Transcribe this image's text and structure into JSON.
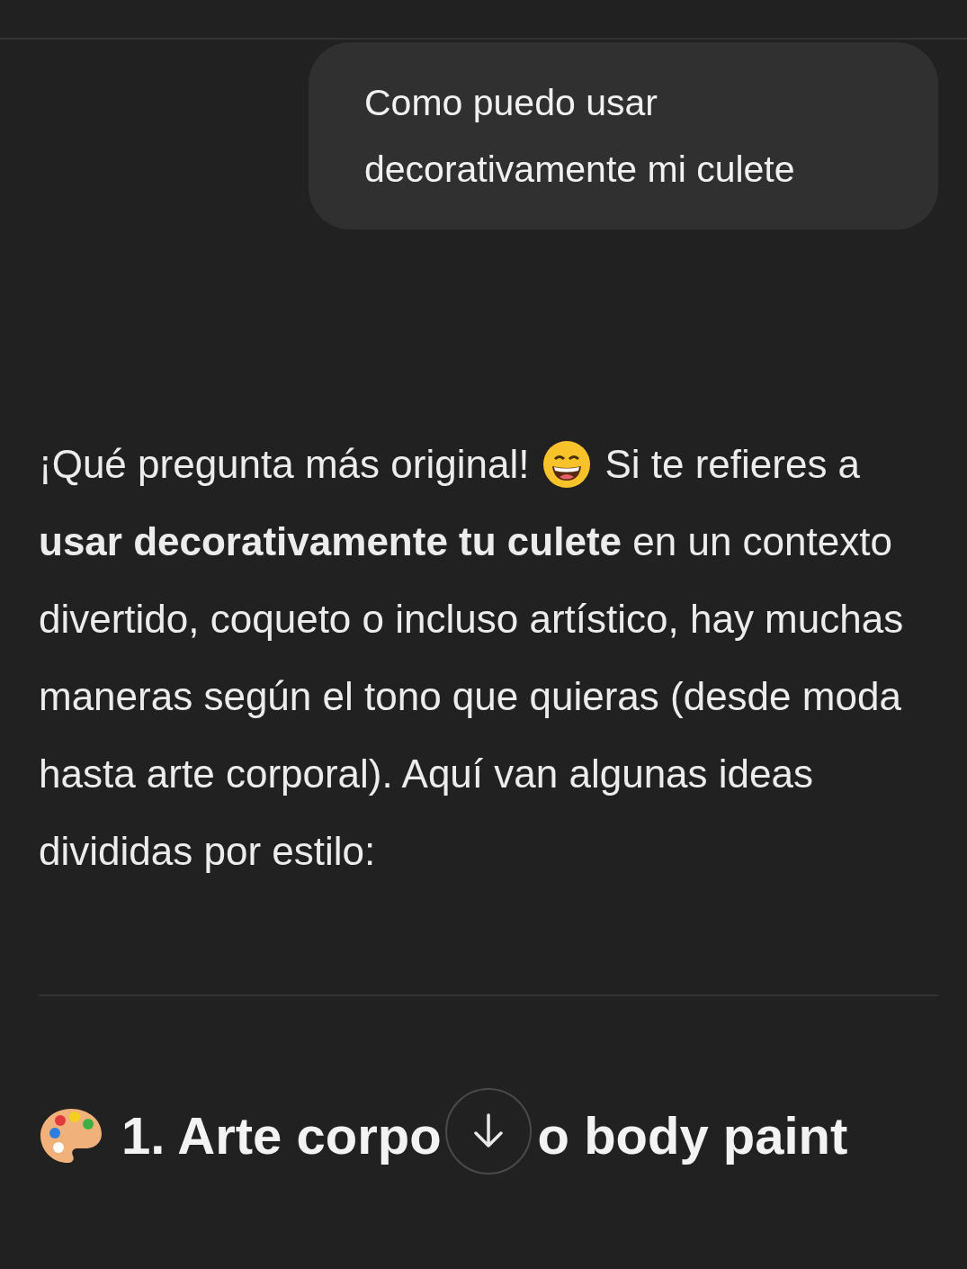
{
  "user_message": {
    "text": "Como puedo usar decorativamente mi culete"
  },
  "reply": {
    "intro": "¡Qué pregunta más original!",
    "after_emoji": "Si te refieres a",
    "text": "**usar decorativamente tu culete** en un contexto divertido, coqueto o incluso artístico, hay muchas maneras según el tono que quieras (desde moda hasta arte corporal). Aquí van algunas ideas divididas por estilo:"
  },
  "heading": {
    "visible_start": "1. Arte corpo",
    "visible_end": "o body paint"
  }
}
